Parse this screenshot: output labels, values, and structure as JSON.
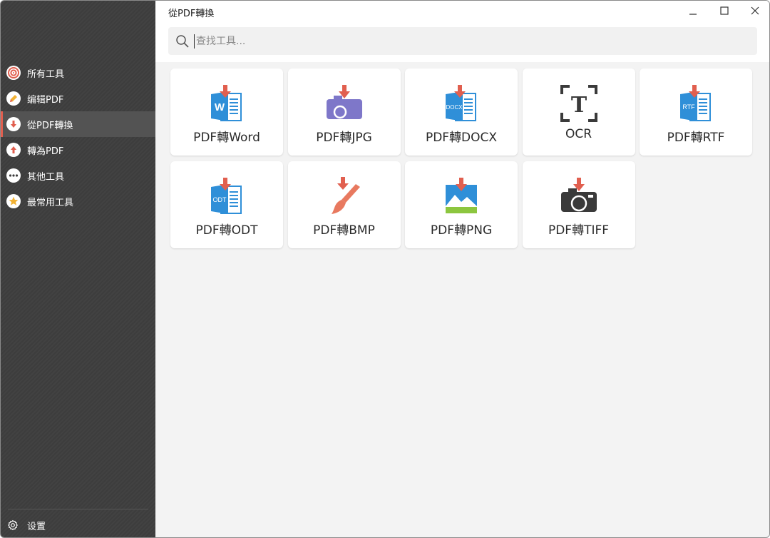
{
  "window": {
    "title": "從PDF轉換"
  },
  "sidebar": {
    "items": [
      {
        "label": "所有工具",
        "icon": "all-tools-icon"
      },
      {
        "label": "编辑PDF",
        "icon": "edit-pdf-icon"
      },
      {
        "label": "從PDF轉換",
        "icon": "convert-from-pdf-icon",
        "active": true
      },
      {
        "label": "轉為PDF",
        "icon": "convert-to-pdf-icon"
      },
      {
        "label": "其他工具",
        "icon": "more-tools-icon"
      },
      {
        "label": "最常用工具",
        "icon": "star-icon"
      }
    ],
    "settings_label": "设置"
  },
  "search": {
    "placeholder": "查找工具..."
  },
  "tools": [
    {
      "label": "PDF轉Word",
      "icon": "word-doc-icon"
    },
    {
      "label": "PDF轉JPG",
      "icon": "jpg-camera-icon"
    },
    {
      "label": "PDF轉DOCX",
      "icon": "docx-doc-icon"
    },
    {
      "label": "OCR",
      "icon": "ocr-text-icon"
    },
    {
      "label": "PDF轉RTF",
      "icon": "rtf-doc-icon"
    },
    {
      "label": "PDF轉ODT",
      "icon": "odt-doc-icon"
    },
    {
      "label": "PDF轉BMP",
      "icon": "bmp-brush-icon"
    },
    {
      "label": "PDF轉PNG",
      "icon": "png-image-icon"
    },
    {
      "label": "PDF轉TIFF",
      "icon": "tiff-camera-icon"
    }
  ],
  "doc_badges": {
    "word": "W",
    "docx": "DOCX",
    "rtf": "RTF",
    "odt": "ODT",
    "ocr": "T"
  },
  "colors": {
    "sidebar_bg": "#3e3e3e",
    "active_bg": "#535353",
    "accent_red": "#e15f4f",
    "doc_blue": "#2f8fd8",
    "jpg_purple": "#7e77c9",
    "png_green": "#8cc63f"
  }
}
